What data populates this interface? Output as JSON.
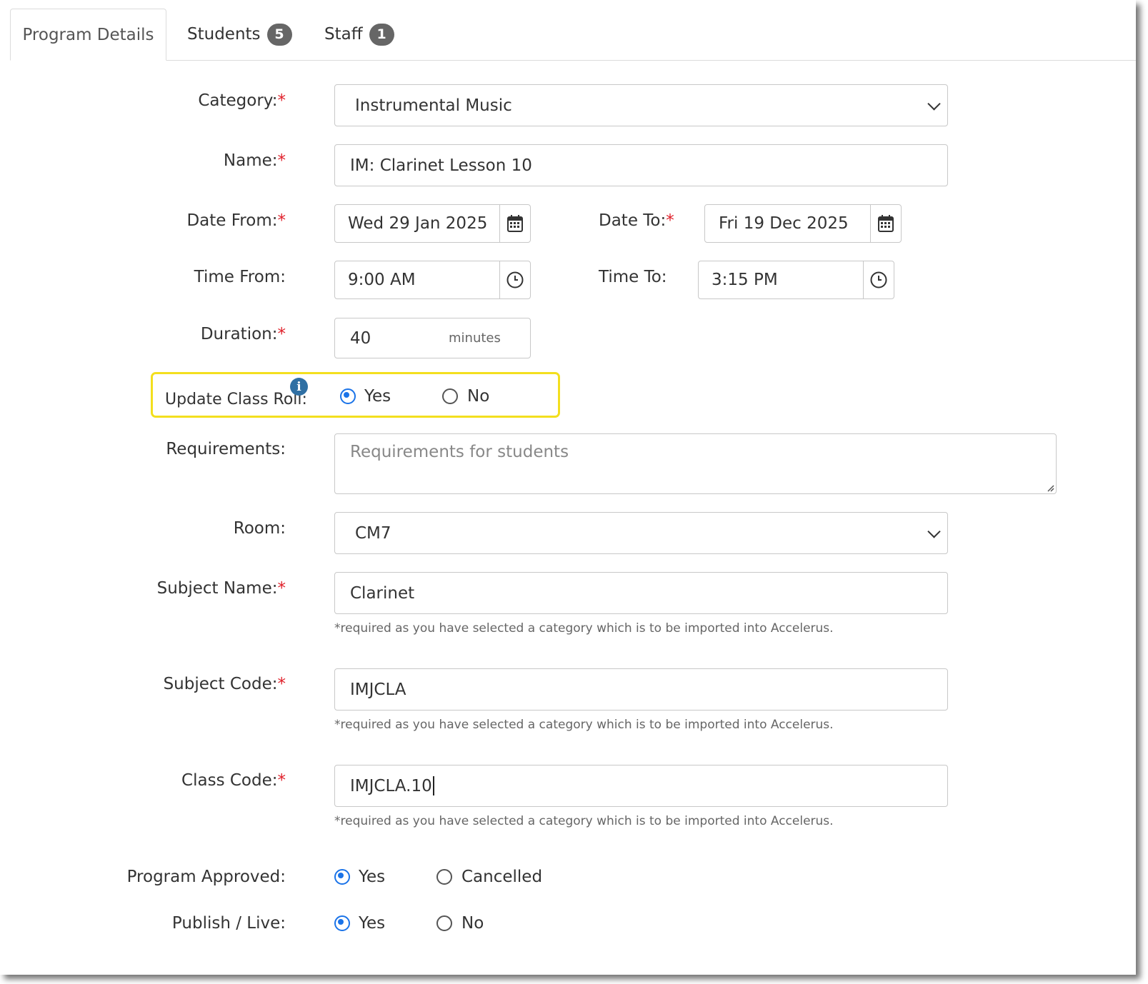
{
  "tabs": {
    "program_details": "Program Details",
    "students": "Students",
    "students_count": "5",
    "staff": "Staff",
    "staff_count": "1"
  },
  "form": {
    "category": {
      "label": "Category:",
      "value": "Instrumental Music"
    },
    "name": {
      "label": "Name:",
      "value": "IM: Clarinet Lesson 10"
    },
    "date_from": {
      "label": "Date From:",
      "value": "Wed 29 Jan 2025"
    },
    "date_to": {
      "label": "Date To:",
      "value": "Fri 19 Dec 2025"
    },
    "time_from": {
      "label": "Time From:",
      "value": "9:00 AM"
    },
    "time_to": {
      "label": "Time To:",
      "value": "3:15 PM"
    },
    "duration": {
      "label": "Duration:",
      "value": "40",
      "unit": "minutes"
    },
    "update_class_roll": {
      "label": "Update Class Roll:",
      "yes": "Yes",
      "no": "No",
      "selected": "Yes"
    },
    "requirements": {
      "label": "Requirements:",
      "placeholder": "Requirements for students"
    },
    "room": {
      "label": "Room:",
      "value": "CM7"
    },
    "subject_name": {
      "label": "Subject Name:",
      "value": "Clarinet"
    },
    "subject_code": {
      "label": "Subject Code:",
      "value": "IMJCLA"
    },
    "class_code": {
      "label": "Class Code:",
      "value": "IMJCLA.10"
    },
    "required_hint": "*required as you have selected a category which is to be imported into Accelerus.",
    "program_approved": {
      "label": "Program Approved:",
      "yes": "Yes",
      "cancelled": "Cancelled",
      "selected": "Yes"
    },
    "publish_live": {
      "label": "Publish / Live:",
      "yes": "Yes",
      "no": "No",
      "selected": "Yes"
    },
    "required_marker": "*"
  },
  "colors": {
    "accent": "#1a73e8",
    "required": "#e0202a",
    "highlight": "#f3df1e",
    "badge": "#666666",
    "info": "#2f6fa3"
  },
  "icons": [
    "calendar-icon",
    "clock-icon",
    "chevron-down-icon",
    "info-icon",
    "resize-handle-icon"
  ]
}
